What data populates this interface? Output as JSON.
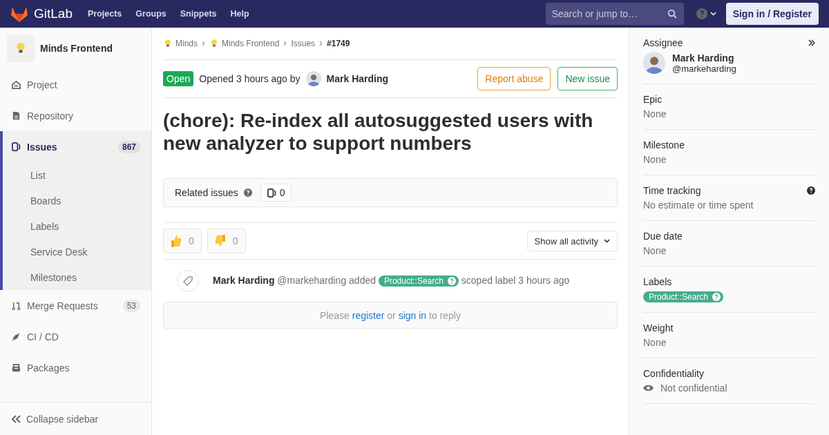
{
  "topbar": {
    "logo": "GitLab",
    "menu": [
      "Projects",
      "Groups",
      "Snippets",
      "Help"
    ],
    "search": {
      "placeholder": "Search or jump to…"
    },
    "sign_in": "Sign in / Register"
  },
  "sidebar": {
    "project": "Minds Frontend",
    "items": [
      {
        "label": "Project",
        "selected": false
      },
      {
        "label": "Repository",
        "selected": false
      },
      {
        "label": "Issues",
        "count": "867",
        "selected": true,
        "children": [
          {
            "label": "List"
          },
          {
            "label": "Boards"
          },
          {
            "label": "Labels"
          },
          {
            "label": "Service Desk"
          },
          {
            "label": "Milestones"
          }
        ]
      },
      {
        "label": "Merge Requests",
        "count": "53",
        "selected": false
      },
      {
        "label": "CI / CD",
        "selected": false
      },
      {
        "label": "Packages",
        "selected": false
      }
    ],
    "collapse": "Collapse sidebar"
  },
  "breadcrumbs": [
    {
      "kind": "project",
      "label": "Minds"
    },
    {
      "kind": "project",
      "label": "Minds Frontend"
    },
    {
      "kind": "page",
      "label": "Issues"
    },
    {
      "kind": "current",
      "label": "#1749"
    }
  ],
  "issue": {
    "status": "Open",
    "opened": "Opened 3 hours ago by",
    "author": "Mark Harding",
    "buttons": [
      {
        "kind": "warning",
        "label": "Report abuse"
      },
      {
        "kind": "success",
        "label": "New issue"
      }
    ],
    "title": "(chore): Re-index all autosuggested users with new analyzer to support numbers"
  },
  "related": {
    "label": "Related issues",
    "count": "0"
  },
  "reactions": [
    {
      "kind": "thumbs_up",
      "count": "0"
    },
    {
      "kind": "thumbs_down",
      "count": "0"
    }
  ],
  "activity_filter": "Show all activity",
  "events": [
    {
      "author": "Mark Harding",
      "handle": "@markeharding",
      "action": "added",
      "label": {
        "text": "Product::Search",
        "color": "#44ad8e"
      },
      "suffix": "scoped label 3 hours ago"
    }
  ],
  "reply": {
    "before": "Please",
    "register": "register",
    "middle": "or",
    "sign_in": "sign in",
    "after": "to reply"
  },
  "right_sidebar": [
    {
      "kind": "user",
      "title": "Assignee",
      "name": "Mark Harding",
      "handle": "@markeharding"
    },
    {
      "kind": "text",
      "title": "Epic",
      "value": "None"
    },
    {
      "kind": "text",
      "title": "Milestone",
      "value": "None"
    },
    {
      "kind": "help",
      "title": "Time tracking",
      "value": "No estimate or time spent"
    },
    {
      "kind": "text",
      "title": "Due date",
      "value": "None"
    },
    {
      "kind": "labels",
      "title": "Labels",
      "labels": [
        {
          "text": "Product::Search",
          "color": "#44ad8e"
        }
      ]
    },
    {
      "kind": "text",
      "title": "Weight",
      "value": "None"
    },
    {
      "kind": "eye",
      "title": "Confidentiality",
      "value": "Not confidential"
    }
  ]
}
